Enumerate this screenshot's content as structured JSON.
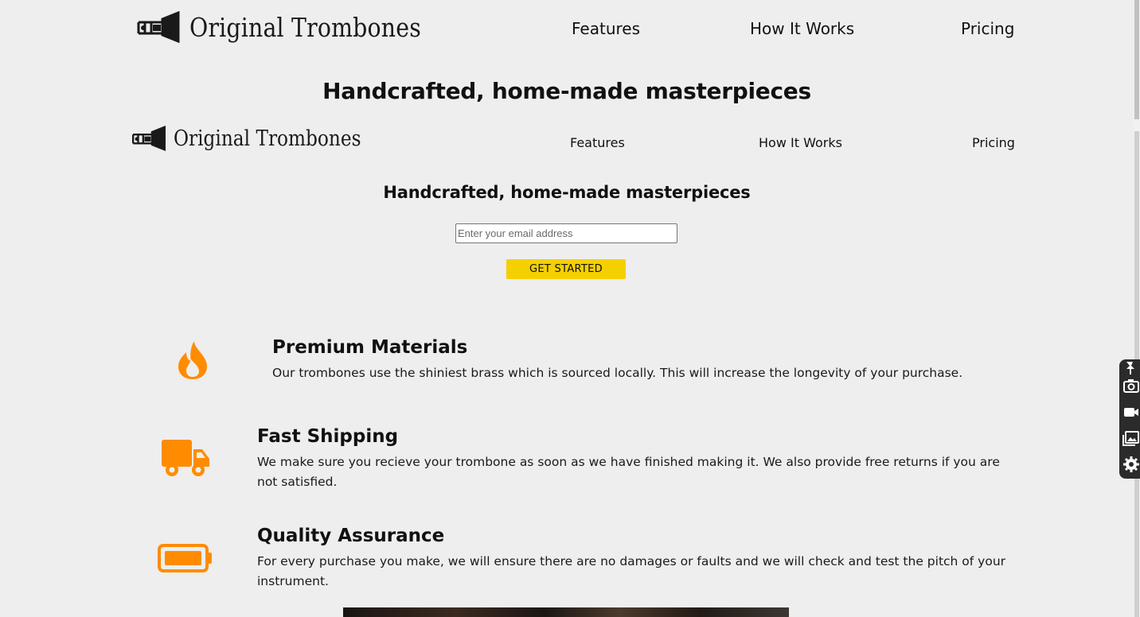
{
  "header": {
    "logo_text": "Original Trombones",
    "logo_icon": "trombone-icon",
    "nav": {
      "features": "Features",
      "how_it_works": "How It Works",
      "pricing": "Pricing"
    },
    "headline": "Handcrafted, home-made masterpieces"
  },
  "header_repeat": {
    "logo_text": "Original Trombones",
    "nav": {
      "features": "Features",
      "how_it_works": "How It Works",
      "pricing": "Pricing"
    },
    "headline": "Handcrafted, home-made masterpieces"
  },
  "form": {
    "email_placeholder": "Enter your email address",
    "submit_label": "GET STARTED"
  },
  "features": [
    {
      "icon": "fire-icon",
      "title": "Premium Materials",
      "text": "Our trombones use the shiniest brass which is sourced locally. This will increase the longevity of your purchase."
    },
    {
      "icon": "truck-icon",
      "title": "Fast Shipping",
      "text": "We make sure you recieve your trombone as soon as we have finished making it. We also provide free returns if you are not satisfied."
    },
    {
      "icon": "battery-icon",
      "title": "Quality Assurance",
      "text": "For every purchase you make, we will ensure there are no damages or faults and we will check and test the pitch of your instrument."
    }
  ],
  "colors": {
    "background": "#eeeeee",
    "accent_orange": "#ff8c00",
    "button_yellow": "#f5d000",
    "text": "#111111"
  },
  "side_tools": [
    "pin-icon",
    "camera-icon",
    "video-icon",
    "gallery-icon",
    "settings-icon"
  ]
}
